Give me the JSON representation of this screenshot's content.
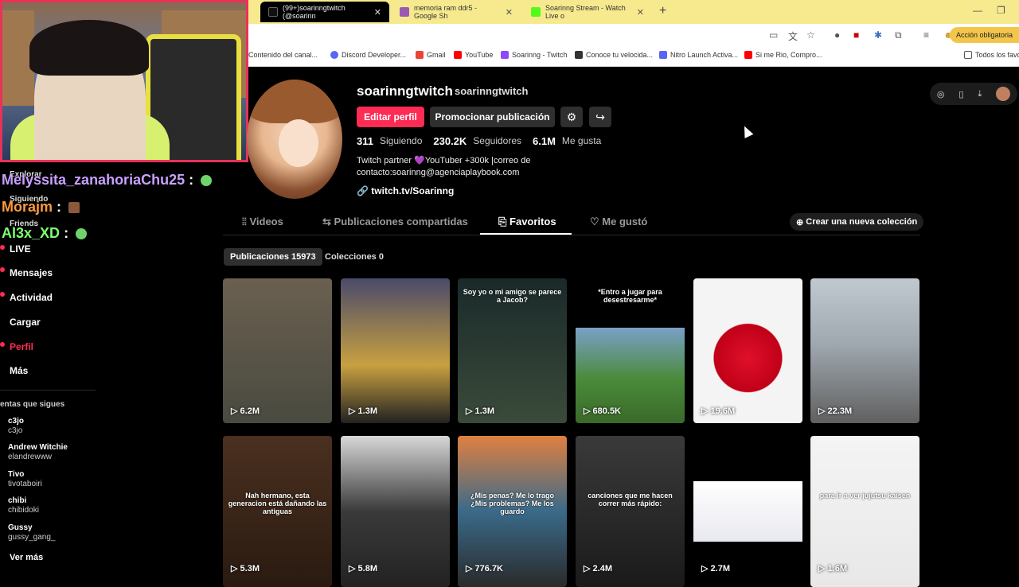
{
  "browser": {
    "tabs": [
      {
        "label": "(99+)soarinngtwitch (@soarinn",
        "active": true,
        "icon_color": "#111111"
      },
      {
        "label": "memoria ram ddr5 - Google Sh",
        "active": false,
        "icon_color": "#9b59b6"
      },
      {
        "label": "Soarinng Stream - Watch Live o",
        "active": false,
        "icon_color": "#53fc18"
      }
    ],
    "close_glyph": "✕",
    "new_tab_glyph": "+",
    "minimize_glyph": "—",
    "maximize_glyph": "❐",
    "address_actions": [
      "cast-icon",
      "translate-icon",
      "star-icon",
      "extension-icon",
      "extension-icon",
      "extension-icon",
      "puzzle-icon",
      "media-icon",
      "profile-icon"
    ],
    "account_button": "Acción obligatoria",
    "bookmarks": [
      {
        "label": "Contenido del canal...",
        "color": "#e22"
      },
      {
        "label": "Discord Developer...",
        "color": "#5865f2"
      },
      {
        "label": "Gmail",
        "color": "#ea4335"
      },
      {
        "label": "YouTube",
        "color": "#ff0000"
      },
      {
        "label": "Soarinng - Twitch",
        "color": "#9146ff"
      },
      {
        "label": "Conoce tu velocida...",
        "color": "#333333"
      },
      {
        "label": "Nitro Launch Activa...",
        "color": "#5865f2"
      },
      {
        "label": "Si me Rio, Compro...",
        "color": "#ff0000"
      }
    ],
    "all_bookmarks": "Todos los favo"
  },
  "stream_chat": [
    {
      "user": "Melyssita_zanahoriaChu25",
      "sep": ":",
      "color": "#c9a0ff"
    },
    {
      "user": "Morajm",
      "sep": ":",
      "color": "#ff9a3c"
    },
    {
      "user": "Al3x_XD",
      "sep": ":",
      "color": "#7dff6e"
    }
  ],
  "sidebar": {
    "items": [
      {
        "label": "Explorar"
      },
      {
        "label": "Siguiendo"
      },
      {
        "label": "Friends"
      },
      {
        "label": "LIVE"
      },
      {
        "label": "Mensajes"
      },
      {
        "label": "Actividad"
      },
      {
        "label": "Cargar"
      },
      {
        "label": "Perfil"
      },
      {
        "label": "Más"
      }
    ],
    "following_title": "entas que sigues",
    "following": [
      {
        "name": "c3jo",
        "handle": "c3jo"
      },
      {
        "name": "Andrew Witchie",
        "handle": "elandrewww"
      },
      {
        "name": "Tivo",
        "handle": "tivotaboiri"
      },
      {
        "name": "chibi",
        "handle": "chibidoki"
      },
      {
        "name": "Gussy",
        "handle": "gussy_gang_"
      }
    ],
    "see_more": "Ver más"
  },
  "profile": {
    "username": "soarinngtwitch",
    "handle": "soarinngtwitch",
    "edit_button": "Editar perfil",
    "promote_button": "Promocionar publicación",
    "stats": [
      {
        "value": "311",
        "label": "Siguiendo"
      },
      {
        "value": "230.2K",
        "label": "Seguidores"
      },
      {
        "value": "6.1M",
        "label": "Me gusta"
      }
    ],
    "bio_line1": "Twitch partner 💜YouTuber +300k |correo de",
    "bio_line2": "contacto:soarinng@agenciaplaybook.com",
    "link": "twitch.tv/Soarinng"
  },
  "content_tabs": [
    {
      "label": "Videos",
      "icon": "grid-icon",
      "glyph": "⦙⦙"
    },
    {
      "label": "Publicaciones compartidas",
      "icon": "repost-icon",
      "glyph": "⇆"
    },
    {
      "label": "Favoritos",
      "icon": "bookmark-icon",
      "glyph": "⎘"
    },
    {
      "label": "Me gustó",
      "icon": "heart-icon",
      "glyph": "♡"
    }
  ],
  "new_collection": "Crear una nueva colección",
  "chips": {
    "posts": "Publicaciones 15973",
    "collections": "Colecciones 0"
  },
  "videos": [
    {
      "views": "6.2M",
      "bg": "linear-gradient(180deg,#6a6050,#4a4a40)",
      "caption": ""
    },
    {
      "views": "1.3M",
      "bg": "linear-gradient(180deg,#4a4a6a,#c8a040 60%,#222)",
      "caption": ""
    },
    {
      "views": "1.3M",
      "bg": "linear-gradient(180deg,#1a2a2a,#3a4a3a)",
      "caption": "Soy yo o mi amigo se parece a Jacob?"
    },
    {
      "views": "680.5K",
      "bg": "linear-gradient(180deg,#000 0%,#000 34%,#7aa0c8 34%,#4a8a3a 70%,#3a6a2a)",
      "caption": "*Entro a jugar para desestresarme*"
    },
    {
      "views": "19.6M",
      "bg": "radial-gradient(circle at 50% 55%,#e0102a 0%,#c00018 35%,#f4f4f4 36%)",
      "caption": ""
    },
    {
      "views": "22.3M",
      "bg": "linear-gradient(180deg,#c0c8d0,#a0a8b0 45%,#606060)",
      "caption": ""
    },
    {
      "views": "5.3M",
      "bg": "linear-gradient(180deg,#4a3020,#2a1a10)",
      "caption": "Nah hermano, esta generacion está dañando las antiguas"
    },
    {
      "views": "5.8M",
      "bg": "linear-gradient(180deg,#d8d8d8,#3a3a3a 50%,#222)",
      "caption": ""
    },
    {
      "views": "776.7K",
      "bg": "linear-gradient(180deg,#e08040,#3a6a8a 50%,#2a2a2a)",
      "caption": "¿Mis penas? Me lo trago ¿Mis problemas? Me los guardo"
    },
    {
      "views": "2.4M",
      "bg": "linear-gradient(180deg,#3a3a3a,#1a1a1a)",
      "caption": "canciones que me hacen correr más rápido:"
    },
    {
      "views": "2.7M",
      "bg": "linear-gradient(180deg,#000 0%,#000 30%,#ffffff 30%,#e8e8f0 70%,#000 70%)",
      "caption": ""
    },
    {
      "views": "1.6M",
      "bg": "linear-gradient(180deg,#f4f4f4,#e8e8e8)",
      "caption": "para ir a ver jujutsu kaisen"
    }
  ],
  "play_glyph": "▷"
}
